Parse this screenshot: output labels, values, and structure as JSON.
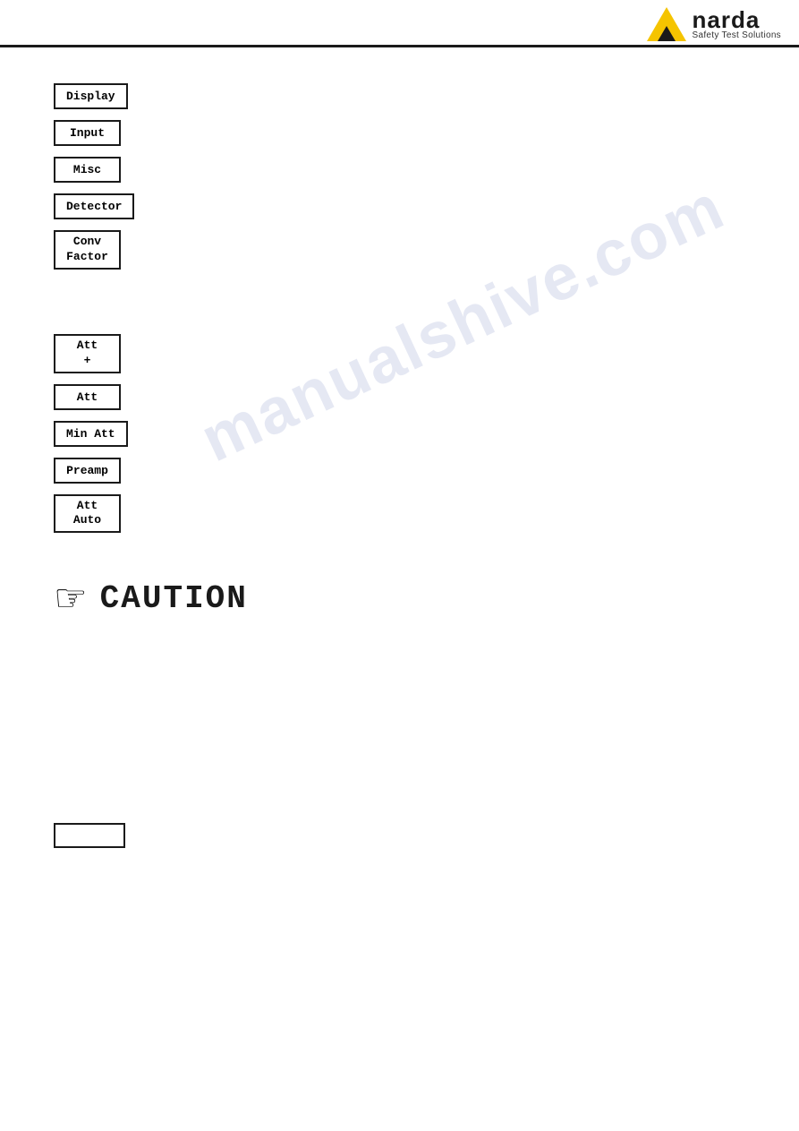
{
  "header": {
    "logo": {
      "brand": "narda",
      "subtitle": "Safety Test Solutions"
    }
  },
  "top_buttons": [
    {
      "label": "Display",
      "id": "display"
    },
    {
      "label": "Input",
      "id": "input"
    },
    {
      "label": "Misc",
      "id": "misc"
    },
    {
      "label": "Detector",
      "id": "detector"
    },
    {
      "label": "Conv\nFactor",
      "id": "conv-factor"
    }
  ],
  "middle_buttons": [
    {
      "label": "Att\n+",
      "id": "att-plus"
    },
    {
      "label": "Att",
      "id": "att"
    },
    {
      "label": "Min Att",
      "id": "min-att"
    },
    {
      "label": "Preamp",
      "id": "preamp"
    },
    {
      "label": "Att\nAuto",
      "id": "att-auto"
    }
  ],
  "watermark": {
    "text": "manualshive.com"
  },
  "caution": {
    "icon": "✋",
    "text": "CAUTION"
  },
  "bottom_button": {
    "label": ""
  }
}
